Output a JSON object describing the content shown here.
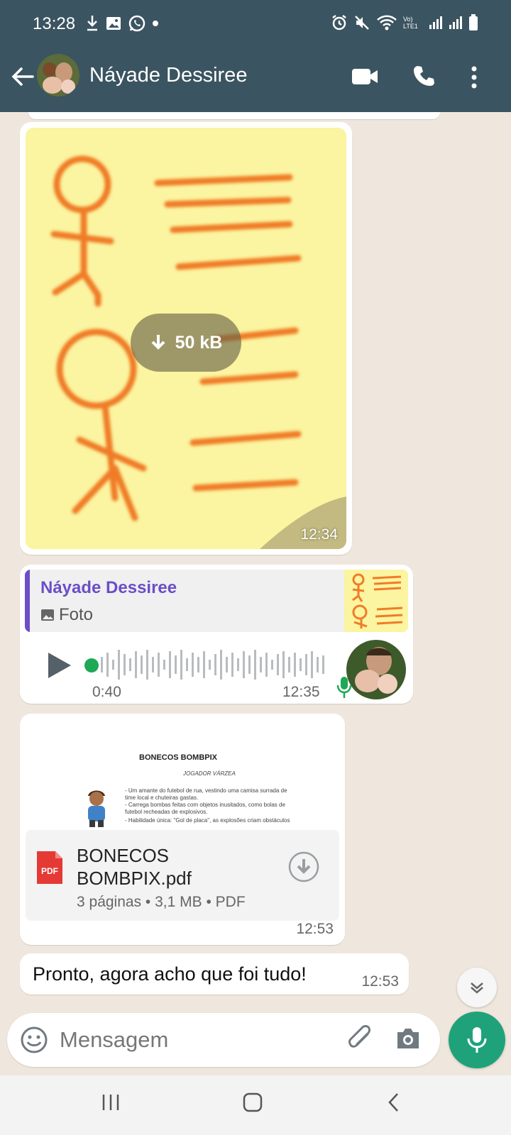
{
  "status_bar": {
    "time": "13:28",
    "lte_label": "Vo) LTE1"
  },
  "header": {
    "contact_name": "Náyade Dessiree"
  },
  "colors": {
    "header_bg": "#3b5461",
    "chat_bg": "#efe7dd",
    "accent_green": "#1fa27a",
    "quote_purple": "#6b4ec8",
    "pdf_red": "#e53935"
  },
  "messages": {
    "image": {
      "download_size": "50 kB",
      "time": "12:34"
    },
    "voice": {
      "quote_author": "Náyade Dessiree",
      "quote_type": "Foto",
      "duration": "0:40",
      "time": "12:35"
    },
    "document": {
      "preview_title": "BONECOS BOMBPIX",
      "preview_subtitle": "JOGADOR VÁRZEA",
      "preview_lines": [
        "- Um amante do futebol de rua, vestindo uma camisa surrada de",
        "time local e chuteiras gastas.",
        "- Carrega bombas feitas com objetos inusitados, como bolas de",
        "futebol recheadas de explosivos.",
        "- Habilidade única: \"Gol de placa\", as explosões criam obstáculos"
      ],
      "pdf_label": "PDF",
      "file_name": "BONECOS BOMBPIX.pdf",
      "meta": "3 páginas • 3,1 MB • PDF",
      "time": "12:53"
    },
    "text": {
      "body": "Pronto, agora acho que foi tudo!",
      "time": "12:53"
    }
  },
  "composer": {
    "placeholder": "Mensagem"
  }
}
